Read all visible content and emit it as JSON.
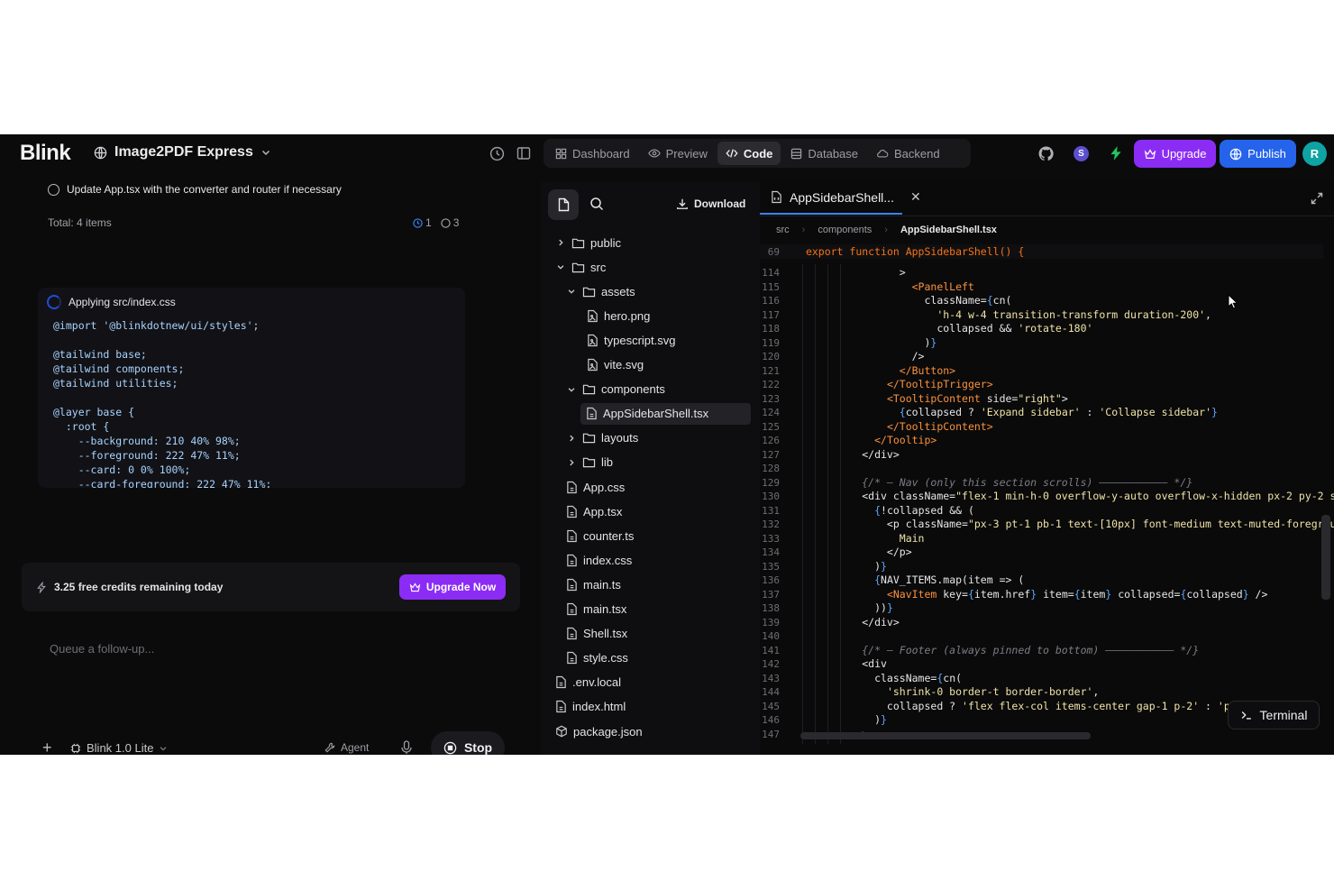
{
  "header": {
    "logo": "Blink",
    "project_name": "Image2PDF Express",
    "tabs": [
      {
        "label": "Dashboard",
        "icon": "grid-icon"
      },
      {
        "label": "Preview",
        "icon": "eye-icon"
      },
      {
        "label": "Code",
        "icon": "code-icon",
        "active": true
      },
      {
        "label": "Database",
        "icon": "database-icon"
      },
      {
        "label": "Backend",
        "icon": "cloud-icon"
      }
    ],
    "avatar_s": "S",
    "upgrade_label": "Upgrade",
    "publish_label": "Publish",
    "avatar_r": "R"
  },
  "chat": {
    "todo_item": "Update App.tsx with the converter and router if necessary",
    "total": "Total: 4 items",
    "count_in_progress": "1",
    "count_pending": "3",
    "applying_label": "Applying src/index.css",
    "css_code": "@import '@blinkdotnew/ui/styles';\n\n@tailwind base;\n@tailwind components;\n@tailwind utilities;\n\n@layer base {\n  :root {\n    --background: 210 40% 98%;\n    --foreground: 222 47% 11%;\n    --card: 0 0% 100%;\n    --card-foreground: 222 47% 11%;",
    "credits_text": "3.25 free credits remaining today",
    "upgrade_now_label": "Upgrade Now",
    "queue_placeholder": "Queue a follow-up...",
    "model_label": "Blink 1.0 Lite",
    "agent_label": "Agent",
    "stop_label": "Stop"
  },
  "tree": {
    "download_label": "Download",
    "items": [
      {
        "name": "public",
        "type": "folder",
        "expanded": false,
        "depth": 0
      },
      {
        "name": "src",
        "type": "folder",
        "expanded": true,
        "depth": 0
      },
      {
        "name": "assets",
        "type": "folder",
        "expanded": true,
        "depth": 1
      },
      {
        "name": "hero.png",
        "type": "image",
        "depth": 2
      },
      {
        "name": "typescript.svg",
        "type": "image",
        "depth": 2
      },
      {
        "name": "vite.svg",
        "type": "image",
        "depth": 2
      },
      {
        "name": "components",
        "type": "folder",
        "expanded": true,
        "depth": 1
      },
      {
        "name": "AppSidebarShell.tsx",
        "type": "file",
        "depth": 2,
        "selected": true
      },
      {
        "name": "layouts",
        "type": "folder",
        "expanded": false,
        "depth": 1
      },
      {
        "name": "lib",
        "type": "folder",
        "expanded": false,
        "depth": 1
      },
      {
        "name": "App.css",
        "type": "file",
        "depth": 1
      },
      {
        "name": "App.tsx",
        "type": "file",
        "depth": 1
      },
      {
        "name": "counter.ts",
        "type": "file",
        "depth": 1
      },
      {
        "name": "index.css",
        "type": "file",
        "depth": 1
      },
      {
        "name": "main.ts",
        "type": "file",
        "depth": 1
      },
      {
        "name": "main.tsx",
        "type": "file",
        "depth": 1
      },
      {
        "name": "Shell.tsx",
        "type": "file",
        "depth": 1
      },
      {
        "name": "style.css",
        "type": "file",
        "depth": 1
      },
      {
        "name": ".env.local",
        "type": "file",
        "depth": 0
      },
      {
        "name": "index.html",
        "type": "file",
        "depth": 0
      },
      {
        "name": "package.json",
        "type": "package",
        "depth": 0
      }
    ]
  },
  "editor": {
    "tab_label": "AppSidebarShell...",
    "breadcrumbs": [
      "src",
      "components",
      "AppSidebarShell.tsx"
    ],
    "sticky_line_number": "69",
    "sticky_code": "export function AppSidebarShell() {",
    "line_numbers": [
      "114",
      "115",
      "116",
      "117",
      "118",
      "119",
      "120",
      "121",
      "122",
      "123",
      "124",
      "125",
      "126",
      "127",
      "128",
      "129",
      "130",
      "131",
      "132",
      "133",
      "134",
      "135",
      "136",
      "137",
      "138",
      "139",
      "140",
      "141",
      "142",
      "143",
      "144",
      "145",
      "146",
      "147"
    ],
    "terminal_label": "Terminal"
  }
}
